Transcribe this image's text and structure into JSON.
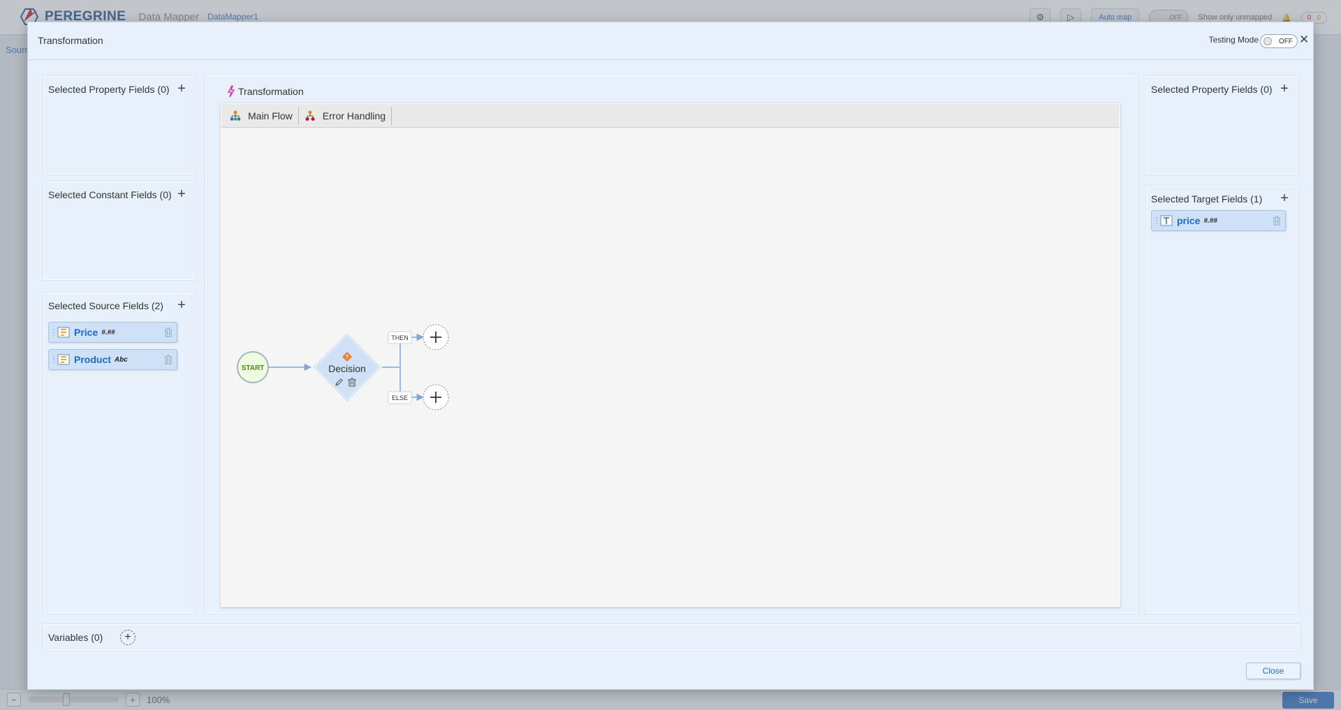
{
  "background": {
    "brand": "PEREGRINE",
    "app_name": "Data Mapper",
    "project": "DataMapper1",
    "auto_map": "Auto map",
    "toggle_state": "OFF",
    "show_unmapped": "Show only unmapped",
    "count_a": "0",
    "count_b": "0",
    "left_label": "Sourc",
    "zoom": "100%",
    "save": "Save"
  },
  "modal": {
    "title": "Transformation",
    "testing_label": "Testing Mode",
    "testing_state": "OFF",
    "close_label": "Close"
  },
  "left": {
    "property": {
      "title": "Selected Property Fields (0)"
    },
    "constant": {
      "title": "Selected Constant Fields (0)"
    },
    "source": {
      "title": "Selected Source Fields (2)",
      "fields": [
        {
          "name": "Price",
          "type": "#.##"
        },
        {
          "name": "Product",
          "type": "Abc"
        }
      ]
    }
  },
  "right": {
    "property": {
      "title": "Selected Property Fields (0)"
    },
    "target": {
      "title": "Selected Target Fields (1)",
      "fields": [
        {
          "name": "price",
          "type": "#.##"
        }
      ]
    }
  },
  "transformation": {
    "title": "Transformation",
    "tabs": [
      {
        "label": "Main Flow"
      },
      {
        "label": "Error Handling"
      }
    ],
    "flow": {
      "start": "START",
      "decision": "Decision",
      "then": "THEN",
      "else": "ELSE"
    }
  },
  "variables": {
    "title": "Variables (0)"
  },
  "colors": {
    "accent": "#1a6cc6",
    "panel_bg": "#e8f1fb",
    "field_bg": "#cfe1f6",
    "decision_fill": "#cfe1f6",
    "decision_icon": "#f07c2a",
    "start_fill": "#f0fadc"
  }
}
